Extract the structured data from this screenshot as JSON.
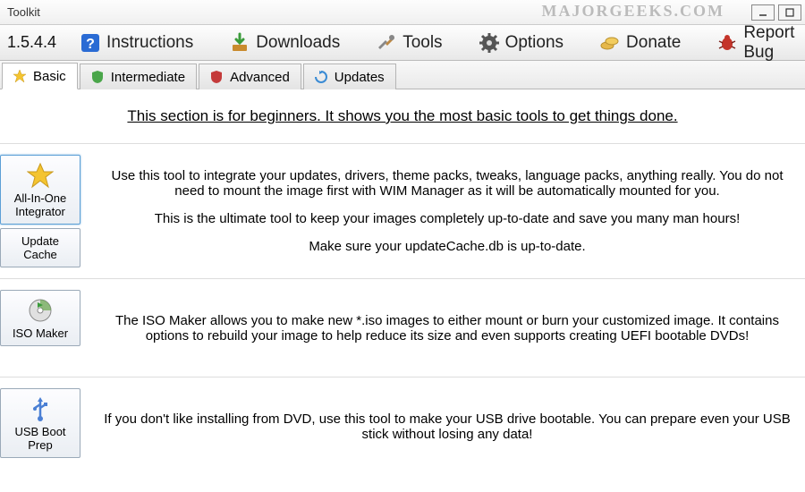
{
  "window": {
    "title": "Toolkit"
  },
  "watermark": "MAJORGEEKS.COM",
  "toolbar": {
    "version": "1.5.4.4",
    "items": [
      {
        "label": "Instructions",
        "icon": "help-icon"
      },
      {
        "label": "Downloads",
        "icon": "download-icon"
      },
      {
        "label": "Tools",
        "icon": "tools-icon"
      },
      {
        "label": "Options",
        "icon": "gear-icon"
      },
      {
        "label": "Donate",
        "icon": "coins-icon"
      },
      {
        "label": "Report Bug",
        "icon": "bug-icon"
      }
    ]
  },
  "tabs": [
    {
      "label": "Basic",
      "icon": "star-icon",
      "active": true
    },
    {
      "label": "Intermediate",
      "icon": "shield-green-icon"
    },
    {
      "label": "Advanced",
      "icon": "shield-red-icon"
    },
    {
      "label": "Updates",
      "icon": "refresh-icon"
    }
  ],
  "section": {
    "intro": "This section is for beginners. It shows you the most basic tools to get things done.",
    "tools": [
      {
        "primary": {
          "label": "All-In-One Integrator",
          "icon": "star-icon"
        },
        "secondary": {
          "label": "Update Cache"
        },
        "desc": [
          "Use this tool to integrate your updates, drivers, theme packs, tweaks, language packs, anything really. You do not need to mount the image first with WIM Manager as it will be automatically mounted for you.",
          "This is the ultimate tool to keep your images completely up-to-date and save you many man hours!",
          "Make sure your updateCache.db is up-to-date."
        ]
      },
      {
        "primary": {
          "label": "ISO Maker",
          "icon": "disc-icon"
        },
        "desc": [
          "The ISO Maker allows you to make new *.iso images to either mount or burn your customized image. It contains options to rebuild your image to help reduce its size and even supports creating UEFI bootable DVDs!"
        ]
      },
      {
        "primary": {
          "label": "USB Boot Prep",
          "icon": "usb-icon"
        },
        "desc": [
          "If you don't like installing from DVD, use this tool to make your USB drive bootable. You can prepare even your USB stick without losing any data!"
        ]
      }
    ]
  }
}
